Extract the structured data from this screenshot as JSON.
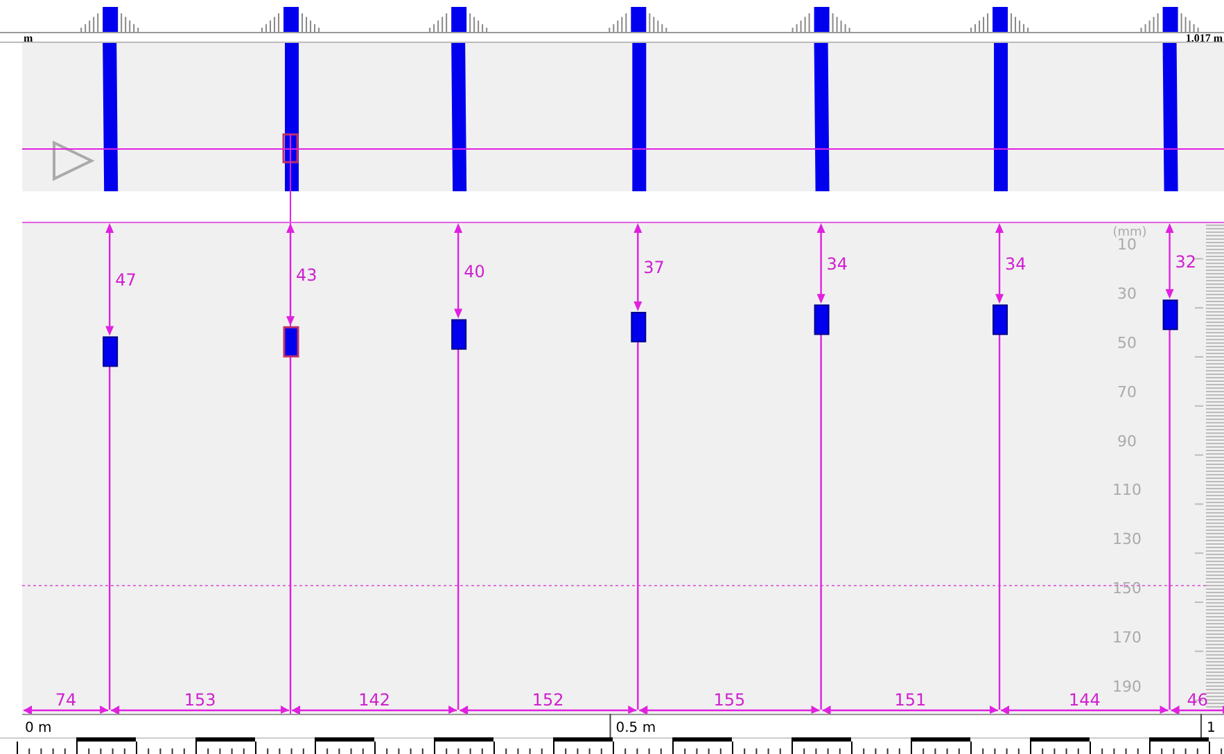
{
  "scan_strip": {
    "start_label": "m",
    "end_label": "1.017 m"
  },
  "depth_axis": {
    "unit": "(mm)",
    "ticks": [
      "10",
      "30",
      "50",
      "70",
      "90",
      "110",
      "130",
      "150",
      "170",
      "190"
    ]
  },
  "rebars": [
    {
      "depth": "47",
      "selected": false
    },
    {
      "depth": "43",
      "selected": true
    },
    {
      "depth": "40",
      "selected": false
    },
    {
      "depth": "37",
      "selected": false
    },
    {
      "depth": "34",
      "selected": false
    },
    {
      "depth": "34",
      "selected": false
    },
    {
      "depth": "32",
      "selected": false
    }
  ],
  "spacings": [
    "74",
    "153",
    "142",
    "152",
    "155",
    "151",
    "144",
    "46"
  ],
  "ruler": {
    "labels": [
      "0 m",
      "0.5 m",
      "1"
    ]
  }
}
